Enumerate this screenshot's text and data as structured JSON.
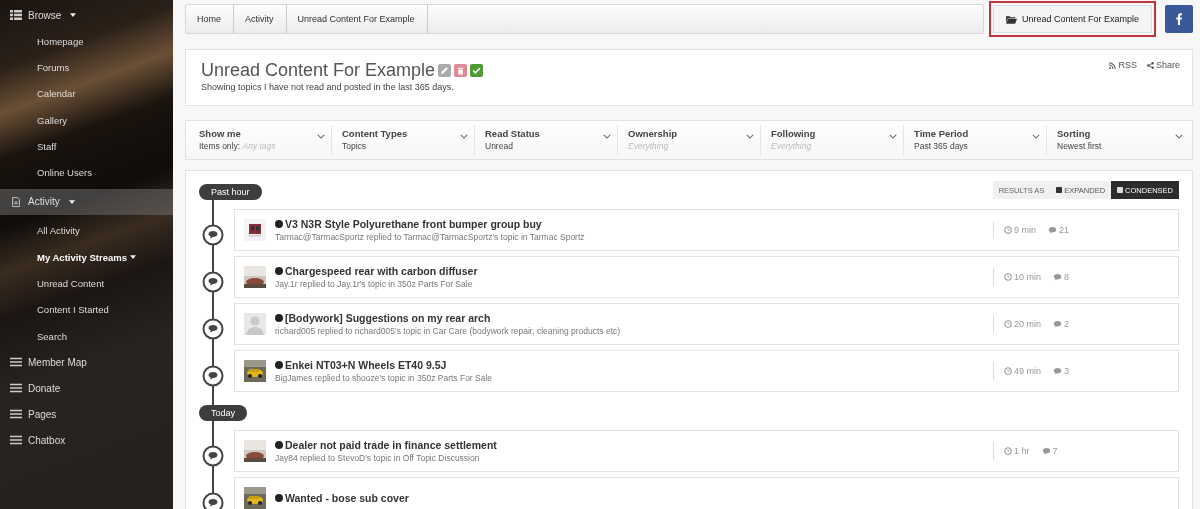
{
  "sidebar": {
    "sections": [
      {
        "label": "Browse",
        "dropdown": true,
        "selected": false,
        "items": [
          {
            "label": "Homepage",
            "selected": false,
            "dropdown": false
          },
          {
            "label": "Forums",
            "selected": false,
            "dropdown": false
          },
          {
            "label": "Calendar",
            "selected": false,
            "dropdown": false
          },
          {
            "label": "Gallery",
            "selected": false,
            "dropdown": false
          },
          {
            "label": "Staff",
            "selected": false,
            "dropdown": false
          },
          {
            "label": "Online Users",
            "selected": false,
            "dropdown": false
          }
        ]
      },
      {
        "label": "Activity",
        "dropdown": true,
        "selected": true,
        "items": [
          {
            "label": "All Activity",
            "selected": false,
            "dropdown": false
          },
          {
            "label": "My Activity Streams",
            "selected": true,
            "dropdown": true
          },
          {
            "label": "Unread Content",
            "selected": false,
            "dropdown": false
          },
          {
            "label": "Content I Started",
            "selected": false,
            "dropdown": false
          },
          {
            "label": "Search",
            "selected": false,
            "dropdown": false
          }
        ]
      },
      {
        "label": "Member Map",
        "dropdown": false,
        "selected": false
      },
      {
        "label": "Donate",
        "dropdown": false,
        "selected": false
      },
      {
        "label": "Pages",
        "dropdown": false,
        "selected": false
      },
      {
        "label": "Chatbox",
        "dropdown": false,
        "selected": false
      }
    ]
  },
  "breadcrumb": [
    "Home",
    "Activity",
    "Unread Content For Example"
  ],
  "header_button": {
    "label": "Unread Content For Example",
    "highlighted": true
  },
  "page": {
    "title": "Unread Content For Example",
    "description": "Showing topics I have not read and posted in the last 365 days.",
    "actions": [
      "RSS",
      "Share"
    ]
  },
  "filters": [
    {
      "label": "Show me",
      "value": "Items only:",
      "hint": "Any tags"
    },
    {
      "label": "Content Types",
      "value": "Topics"
    },
    {
      "label": "Read Status",
      "value": "Unread"
    },
    {
      "label": "Ownership",
      "hint": "Everything"
    },
    {
      "label": "Following",
      "hint": "Everything"
    },
    {
      "label": "Time Period",
      "value": "Past 365 days"
    },
    {
      "label": "Sorting",
      "value": "Newest first"
    }
  ],
  "view_toggle": {
    "label": "RESULTS AS",
    "options": [
      {
        "label": "EXPANDED",
        "selected": false
      },
      {
        "label": "CONDENSED",
        "selected": true
      }
    ]
  },
  "groups": [
    {
      "label": "Past hour",
      "items": [
        {
          "title": "V3 N3R Style Polyurethane front bumper group buy",
          "subtitle": "Tarmac@TarmacSportz replied to Tarmac@TarmacSportz's topic in Tarmac Sportz",
          "time": "9 min",
          "replies": "21",
          "unread": true
        },
        {
          "title": "Chargespeed rear with carbon diffuser",
          "subtitle": "Jay.1r replied to Jay.1r's topic in 350z Parts For Sale",
          "time": "10 min",
          "replies": "8",
          "unread": true
        },
        {
          "title": "[Bodywork] Suggestions on my rear arch",
          "subtitle": "richard005 replied to richard005's topic in Car Care (bodywork repair, cleaning products etc)",
          "time": "20 min",
          "replies": "2",
          "unread": true
        },
        {
          "title": "Enkei NT03+N Wheels ET40 9.5J",
          "subtitle": "BigJames replied to shooze's topic in 350z Parts For Sale",
          "time": "49 min",
          "replies": "3",
          "unread": true
        }
      ]
    },
    {
      "label": "Today",
      "items": [
        {
          "title": "Dealer not paid trade in finance settlement",
          "subtitle": "Jay84 replied to StevoD's topic in Off Topic Discussion",
          "time": "1 hr",
          "replies": "7",
          "unread": true
        },
        {
          "title": "Wanted - bose sub cover",
          "unread": true
        }
      ]
    }
  ]
}
